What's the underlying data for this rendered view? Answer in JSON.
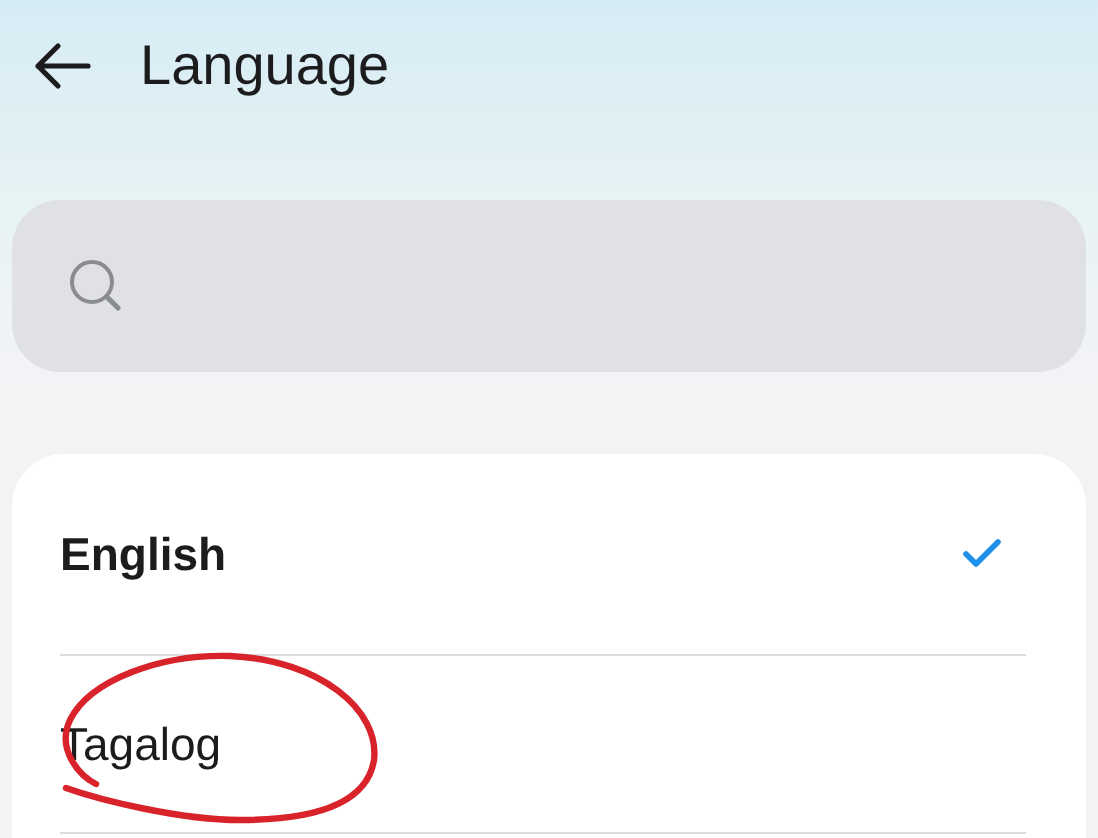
{
  "header": {
    "title": "Language"
  },
  "languages": [
    {
      "name": "English",
      "selected": true
    },
    {
      "name": "Tagalog",
      "selected": false
    }
  ]
}
